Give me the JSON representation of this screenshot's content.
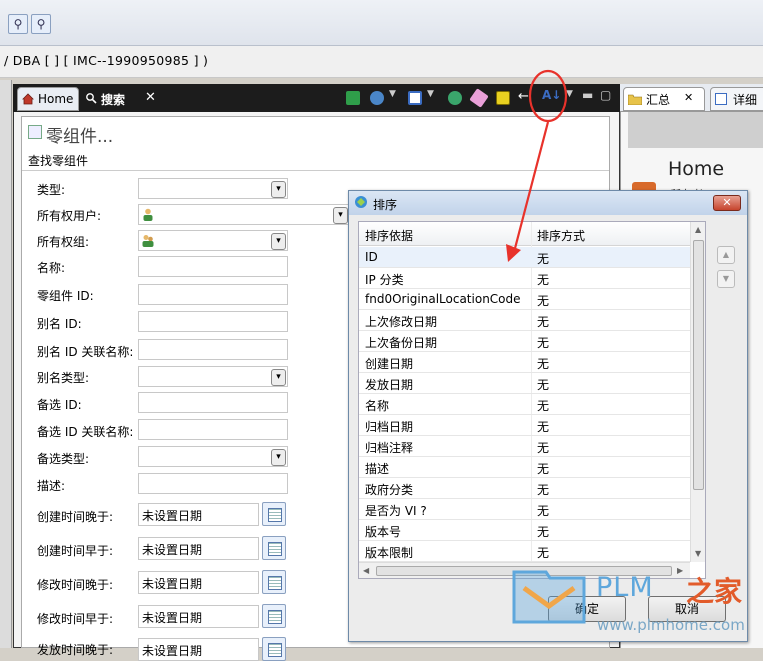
{
  "path_bar": {
    "text": "/ DBA    [  ]    [ IMC--1990950985 ] )"
  },
  "tabs": {
    "home": "Home",
    "search": "搜索"
  },
  "form": {
    "title": "零组件...",
    "subtitle": "查找零组件",
    "fields": [
      {
        "label": "类型:",
        "kind": "select"
      },
      {
        "label": "所有权用户:",
        "kind": "user-select"
      },
      {
        "label": "所有权组:",
        "kind": "group-select"
      },
      {
        "label": "名称:",
        "kind": "text"
      },
      {
        "label": "零组件 ID:",
        "kind": "text"
      },
      {
        "label": "别名 ID:",
        "kind": "text"
      },
      {
        "label": "别名 ID 关联名称:",
        "kind": "text"
      },
      {
        "label": "别名类型:",
        "kind": "select"
      },
      {
        "label": "备选 ID:",
        "kind": "text"
      },
      {
        "label": "备选 ID 关联名称:",
        "kind": "text"
      },
      {
        "label": "备选类型:",
        "kind": "select"
      },
      {
        "label": "描述:",
        "kind": "text"
      }
    ],
    "date_fields": [
      {
        "label": "创建时间晚于:",
        "value": "未设置日期"
      },
      {
        "label": "创建时间早于:",
        "value": "未设置日期"
      },
      {
        "label": "修改时间晚于:",
        "value": "未设置日期"
      },
      {
        "label": "修改时间早于:",
        "value": "未设置日期"
      },
      {
        "label": "发放时间晚于:",
        "value": "未设置日期"
      }
    ]
  },
  "right_panel": {
    "tab1": "汇总",
    "tab2": "详细",
    "home": "Home",
    "partial": "所有者"
  },
  "dialog": {
    "title": "排序",
    "col1": "排序依据",
    "col2": "排序方式",
    "rows": [
      {
        "name": "ID",
        "order": "无"
      },
      {
        "name": "IP 分类",
        "order": "无"
      },
      {
        "name": "fnd0OriginalLocationCode",
        "order": "无"
      },
      {
        "name": "上次修改日期",
        "order": "无"
      },
      {
        "name": "上次备份日期",
        "order": "无"
      },
      {
        "name": "创建日期",
        "order": "无"
      },
      {
        "name": "发放日期",
        "order": "无"
      },
      {
        "name": "名称",
        "order": "无"
      },
      {
        "name": "归档日期",
        "order": "无"
      },
      {
        "name": "归档注释",
        "order": "无"
      },
      {
        "name": "描述",
        "order": "无"
      },
      {
        "name": "政府分类",
        "order": "无"
      },
      {
        "name": "是否为 VI ?",
        "order": "无"
      },
      {
        "name": "版本号",
        "order": "无"
      },
      {
        "name": "版本限制",
        "order": "无"
      }
    ],
    "ok": "确定",
    "cancel": "取消"
  },
  "watermark": {
    "brand": "PLM",
    "brand_cn": "之家",
    "url": "www.plmhome.com"
  },
  "colors": {
    "annotation_red": "#e8322b",
    "tab_dark": "#1c1c1c",
    "dialog_title": "#c1d3ea"
  }
}
